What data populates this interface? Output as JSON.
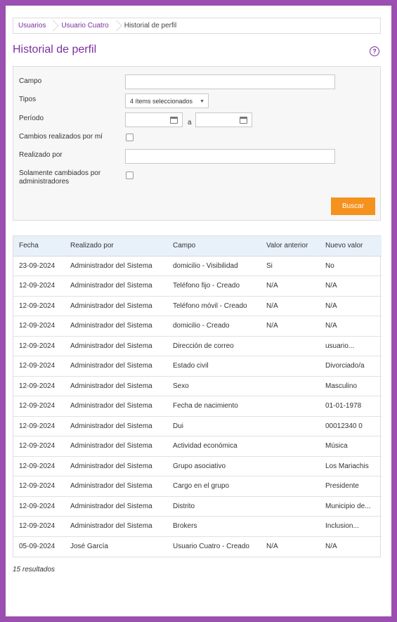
{
  "breadcrumb": {
    "items": [
      {
        "label": "Usuarios"
      },
      {
        "label": "Usuario Cuatro"
      }
    ],
    "current": "Historial de perfil"
  },
  "page": {
    "title": "Historial de perfil",
    "help_icon": "?"
  },
  "filters": {
    "campo_label": "Campo",
    "campo_value": "",
    "tipos_label": "Tipos",
    "tipos_value": "4 ítems seleccionados",
    "periodo_label": "Período",
    "periodo_from": "",
    "periodo_sep": "a",
    "periodo_to": "",
    "cambios_label": "Cambios realizados por mí",
    "realizado_label": "Realizado por",
    "realizado_value": "",
    "solamente_label": "Solamente cambiados por administradores",
    "search_label": "Buscar"
  },
  "table": {
    "columns": [
      "Fecha",
      "Realizado por",
      "Campo",
      "Valor anterior",
      "Nuevo valor"
    ],
    "rows": [
      [
        "23-09-2024",
        "Administrador del Sistema",
        "domicilio - Visibilidad",
        "Si",
        "No"
      ],
      [
        "12-09-2024",
        "Administrador del Sistema",
        "Teléfono fijo - Creado",
        "N/A",
        "N/A"
      ],
      [
        "12-09-2024",
        "Administrador del Sistema",
        "Teléfono móvil - Creado",
        "N/A",
        "N/A"
      ],
      [
        "12-09-2024",
        "Administrador del Sistema",
        "domicilio - Creado",
        "N/A",
        "N/A"
      ],
      [
        "12-09-2024",
        "Administrador del Sistema",
        "Dirección de correo",
        "",
        "usuario..."
      ],
      [
        "12-09-2024",
        "Administrador del Sistema",
        "Estado civil",
        "",
        "Divorciado/a"
      ],
      [
        "12-09-2024",
        "Administrador del Sistema",
        "Sexo",
        "",
        "Masculino"
      ],
      [
        "12-09-2024",
        "Administrador del Sistema",
        "Fecha de nacimiento",
        "",
        "01-01-1978"
      ],
      [
        "12-09-2024",
        "Administrador del Sistema",
        "Dui",
        "",
        "00012340 0"
      ],
      [
        "12-09-2024",
        "Administrador del Sistema",
        "Actividad económica",
        "",
        "Música"
      ],
      [
        "12-09-2024",
        "Administrador del Sistema",
        "Grupo asociativo",
        "",
        "Los Mariachis"
      ],
      [
        "12-09-2024",
        "Administrador del Sistema",
        "Cargo en el grupo",
        "",
        "Presidente"
      ],
      [
        "12-09-2024",
        "Administrador del Sistema",
        "Distrito",
        "",
        "Municipio de..."
      ],
      [
        "12-09-2024",
        "Administrador del Sistema",
        "Brokers",
        "",
        "Inclusion..."
      ],
      [
        "05-09-2024",
        "José García",
        "Usuario Cuatro - Creado",
        "N/A",
        "N/A"
      ]
    ]
  },
  "results_count": "15 resultados",
  "colors": {
    "accent": "#7b2fa0",
    "button": "#f5921e",
    "frame": "#9b4fb0",
    "table_header": "#e8f1fa"
  }
}
